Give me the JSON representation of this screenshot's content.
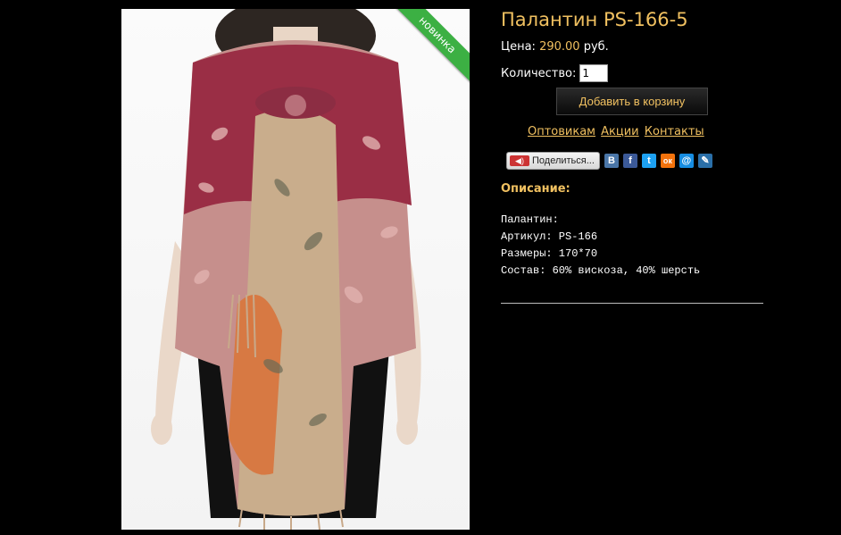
{
  "product": {
    "title": "Палантин PS-166-5",
    "badge": "новинка",
    "price_label": "Цена:",
    "price_value": "290.00",
    "price_currency": "руб.",
    "qty_label": "Количество:",
    "qty_value": "1",
    "add_to_cart": "Добавить в корзину"
  },
  "links": [
    "Оптовикам",
    "Акции",
    "Контакты"
  ],
  "share": {
    "label": "Поделиться...",
    "icons": [
      {
        "name": "vkontakte-icon",
        "glyph": "В",
        "color": "#4a76a8"
      },
      {
        "name": "facebook-icon",
        "glyph": "f",
        "color": "#3b5998"
      },
      {
        "name": "twitter-icon",
        "glyph": "t",
        "color": "#1da1f2"
      },
      {
        "name": "odnoklassniki-icon",
        "glyph": "ок",
        "color": "#f2720c"
      },
      {
        "name": "mailru-icon",
        "glyph": "@",
        "color": "#168de2"
      },
      {
        "name": "livejournal-icon",
        "glyph": "✎",
        "color": "#2a6fa8"
      }
    ]
  },
  "description": {
    "heading": "Описание:",
    "lines": [
      "Палантин:",
      "Артикул: PS-166",
      "Размеры: 170*70",
      "Состав: 60% вискоза, 40% шерсть"
    ]
  },
  "colors": {
    "accent": "#f0c060",
    "background": "#000000",
    "badge": "#3cb043"
  }
}
